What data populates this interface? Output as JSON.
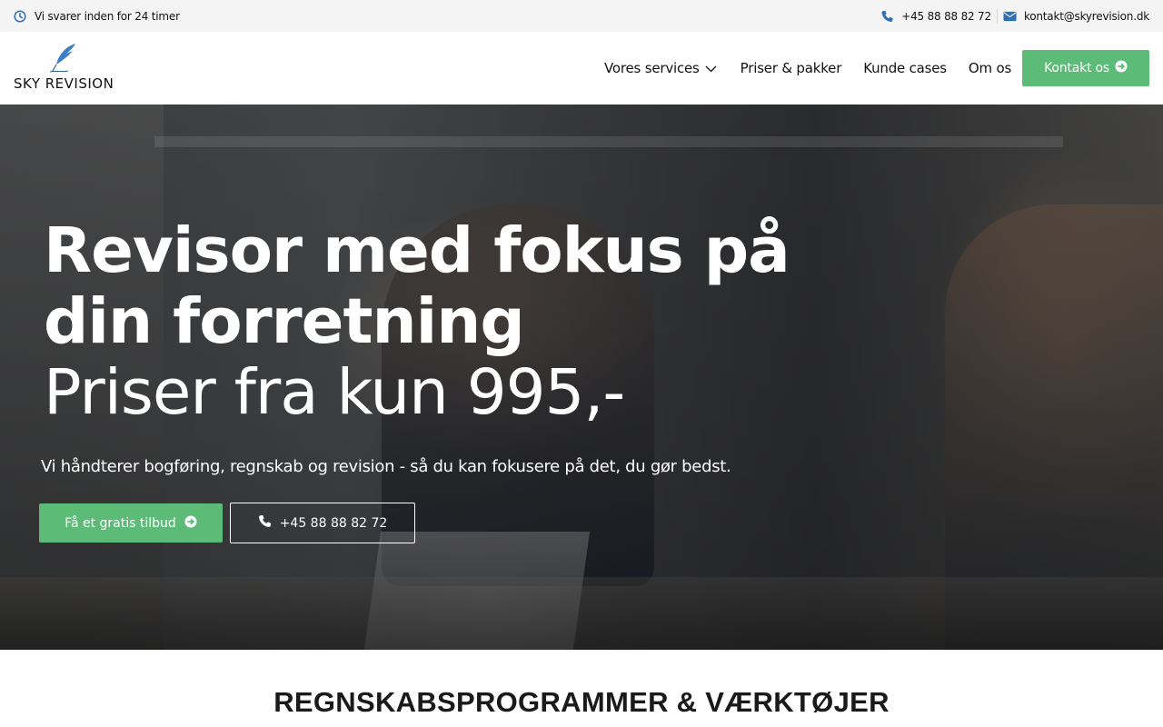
{
  "topbar": {
    "response_text": "Vi svarer inden for 24 timer",
    "phone": "+45 88 88 82 72",
    "email": "kontakt@skyrevision.dk",
    "icons": [
      "clock-icon",
      "phone-icon",
      "envelope-icon"
    ],
    "icon_color": "#2f6fb3"
  },
  "header": {
    "logo_text": "SKY REVISION",
    "nav": {
      "services": "Vores services",
      "pricing": "Priser & pakker",
      "cases": "Kunde cases",
      "about": "Om os",
      "contact": "Kontakt os"
    },
    "accent_color": "#5dbb78"
  },
  "hero": {
    "title": "Revisor med fokus på din forretning",
    "price_line": "Priser fra kun 995,-",
    "subtitle": "Vi håndterer bogføring, regnskab og revision - så du kan fokusere på det, du gør bedst.",
    "cta_label": "Få et gratis tilbud",
    "phone_label": "+45 88 88 82 72"
  },
  "section": {
    "title": "REGNSKABSPROGRAMMER & VÆRKTØJER"
  }
}
